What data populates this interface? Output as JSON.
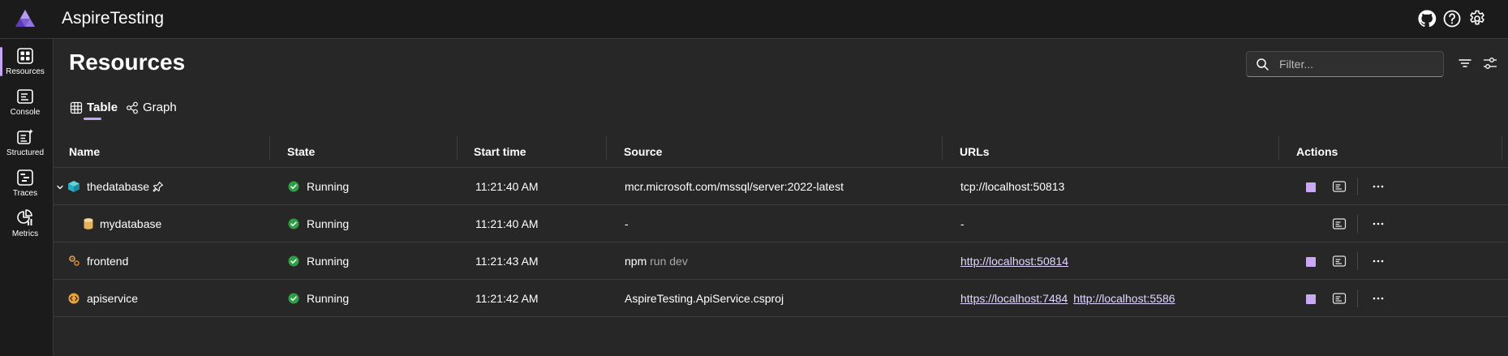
{
  "app": {
    "title": "AspireTesting"
  },
  "header_icons": [
    "github-icon",
    "help-icon",
    "settings-icon"
  ],
  "sidebar": {
    "items": [
      {
        "label": "Resources",
        "icon": "resources-icon",
        "active": true
      },
      {
        "label": "Console",
        "icon": "console-icon",
        "active": false
      },
      {
        "label": "Structured",
        "icon": "structured-icon",
        "active": false
      },
      {
        "label": "Traces",
        "icon": "traces-icon",
        "active": false
      },
      {
        "label": "Metrics",
        "icon": "metrics-icon",
        "active": false
      }
    ]
  },
  "page": {
    "title": "Resources"
  },
  "filter": {
    "placeholder": "Filter...",
    "value": ""
  },
  "tabs": [
    {
      "label": "Table",
      "icon": "table-icon",
      "active": true
    },
    {
      "label": "Graph",
      "icon": "graph-icon",
      "active": false
    }
  ],
  "table": {
    "columns": [
      "Name",
      "State",
      "Start time",
      "Source",
      "URLs",
      "Actions"
    ],
    "rows": [
      {
        "name": "thedatabase",
        "icon": "container-icon",
        "expandable": true,
        "pinned": true,
        "state": "Running",
        "start_time": "11:21:40 AM",
        "source": "mcr.microsoft.com/mssql/server:2022-latest",
        "source_args": "",
        "url_text": "tcp://localhost:50813",
        "urls": [],
        "has_stop": true
      },
      {
        "name": "mydatabase",
        "icon": "database-icon",
        "expandable": false,
        "pinned": false,
        "state": "Running",
        "start_time": "11:21:40 AM",
        "source": "-",
        "source_args": "",
        "url_text": "-",
        "urls": [],
        "has_stop": false
      },
      {
        "name": "frontend",
        "icon": "executable-icon",
        "expandable": false,
        "pinned": false,
        "state": "Running",
        "start_time": "11:21:43 AM",
        "source": "npm",
        "source_args": "run dev",
        "url_text": "",
        "urls": [
          "http://localhost:50814"
        ],
        "has_stop": true
      },
      {
        "name": "apiservice",
        "icon": "project-icon",
        "expandable": false,
        "pinned": false,
        "state": "Running",
        "start_time": "11:21:42 AM",
        "source": "AspireTesting.ApiService.csproj",
        "source_args": "",
        "url_text": "",
        "urls": [
          "https://localhost:7484",
          "http://localhost:5586"
        ],
        "has_stop": true
      }
    ]
  },
  "colors": {
    "accent": "#c5a6f2",
    "running": "#2ea043",
    "background": "#272727",
    "chrome": "#1b1b1b",
    "link": "#e3d6ff"
  }
}
